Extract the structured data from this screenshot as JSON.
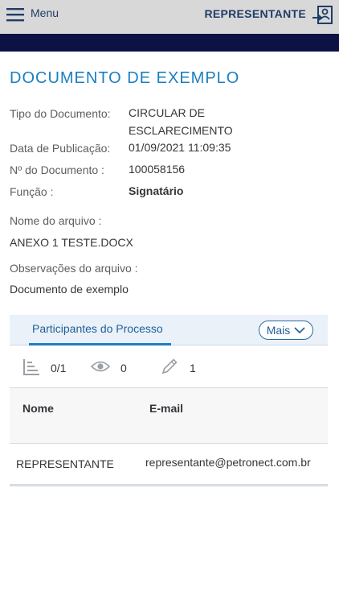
{
  "header": {
    "menu_label": "Menu",
    "user_label": "REPRESENTANTE",
    "menu_icon": "hamburger-icon",
    "logout_icon": "logout-icon",
    "colors": {
      "bar": "#d8d8d8",
      "dark_strip": "#0c1243",
      "brand_text": "#1f3d68"
    }
  },
  "document": {
    "title": "DOCUMENTO DE EXEMPLO",
    "fields": {
      "tipo_label": "Tipo do Documento:",
      "tipo_value_line1": "CIRCULAR DE",
      "tipo_value_line2": "ESCLARECIMENTO",
      "data_label": "Data de Publicação:",
      "data_value": "01/09/2021 11:09:35",
      "numero_label": "Nº do Documento :",
      "numero_value": "100058156",
      "funcao_label": "Função :",
      "funcao_value": "Signatário"
    },
    "arquivo_label": "Nome do arquivo :",
    "arquivo_value": "ANEXO 1 TESTE.DOCX",
    "observacoes_label": "Observações do arquivo :",
    "observacoes_value": "Documento de exemplo"
  },
  "participants": {
    "tab_label": "Participantes do Processo",
    "more_label": "Mais",
    "stats": [
      {
        "icon": "hierarchy-icon",
        "value": "0/1"
      },
      {
        "icon": "eye-icon",
        "value": "0"
      },
      {
        "icon": "pencil-icon",
        "value": "1"
      }
    ],
    "columns": [
      "Nome",
      "E-mail"
    ],
    "rows": [
      {
        "nome": "REPRESENTANTE",
        "email": "representante@petronect.com.br"
      }
    ],
    "accent": "#1d7dc1"
  }
}
